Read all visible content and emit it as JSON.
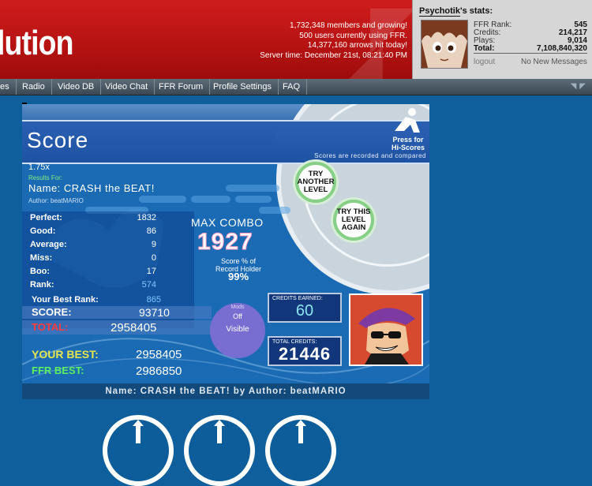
{
  "header": {
    "logo_text": "lution",
    "site_stats": [
      "1,732,348 members and growing!",
      "500 users currently using FFR.",
      "14,377,160 arrows hit today!",
      "Server time: December 21st, 08:21:40 PM"
    ]
  },
  "user": {
    "name": "Psychotik",
    "name_suffix": "'s stats:",
    "stats": [
      {
        "label": "FFR Rank:",
        "value": "545"
      },
      {
        "label": "Credits:",
        "value": "214,217"
      },
      {
        "label": "Plays:",
        "value": "9,014"
      },
      {
        "label": "Total:",
        "value": "7,108,840,320"
      }
    ],
    "logout": "logout",
    "messages": "No New Messages"
  },
  "nav": [
    "es",
    "Radio",
    "Video DB",
    "Video Chat",
    "FFR Forum",
    "Profile Settings",
    "FAQ"
  ],
  "game": {
    "title": "Score",
    "press_for": "Press for",
    "hi_scores": "Hi-Scores",
    "recorded_note": "Scores are recorded and compared",
    "speed": "1.75x",
    "results_for": "Results For:",
    "song_name": "Name: CRASH the BEAT!",
    "author": "Author: beatMARIO",
    "btn_try_another": "TRY ANOTHER LEVEL",
    "btn_try_again": "TRY THIS LEVEL AGAIN",
    "judgements": [
      {
        "label": "Perfect:",
        "value": "1832"
      },
      {
        "label": "Good:",
        "value": "86"
      },
      {
        "label": "Average:",
        "value": "9"
      },
      {
        "label": "Miss:",
        "value": "0"
      },
      {
        "label": "Boo:",
        "value": "17"
      },
      {
        "label": "Rank:",
        "value": "574"
      }
    ],
    "max_combo_label": "MAX COMBO",
    "max_combo": "1927",
    "record_pct_label1": "Score % of",
    "record_pct_label2": "Record Holder",
    "record_pct": "99%",
    "best_rank_label": "Your Best Rank:",
    "best_rank": "865",
    "score_label": "SCORE:",
    "score": "93710",
    "total_label": "TOTAL:",
    "total": "2958405",
    "mods_label": "Mods",
    "mods_off": "Off",
    "mods_visible": "Visible",
    "credits_earned_label": "CREDITS EARNED:",
    "credits_earned": "60",
    "total_credits_label": "TOTAL CREDITS:",
    "total_credits": "21446",
    "your_best_label": "YOUR BEST:",
    "your_best": "2958405",
    "ffr_best_label": "FFR BEST:",
    "ffr_best": "2986850",
    "song_bar": "Name: CRASH the BEAT! by Author: beatMARIO"
  },
  "colors": {
    "header_red": "#c41a1a",
    "page_blue": "#0e5f9c",
    "game_blue": "#1a6bb4",
    "total_red": "#ff3b3b",
    "your_best_yellow": "#e6e64a",
    "ffr_best_green": "#5ef05e",
    "combo_pink": "#ff9fc0",
    "credits_cyan": "#8de3f0"
  }
}
